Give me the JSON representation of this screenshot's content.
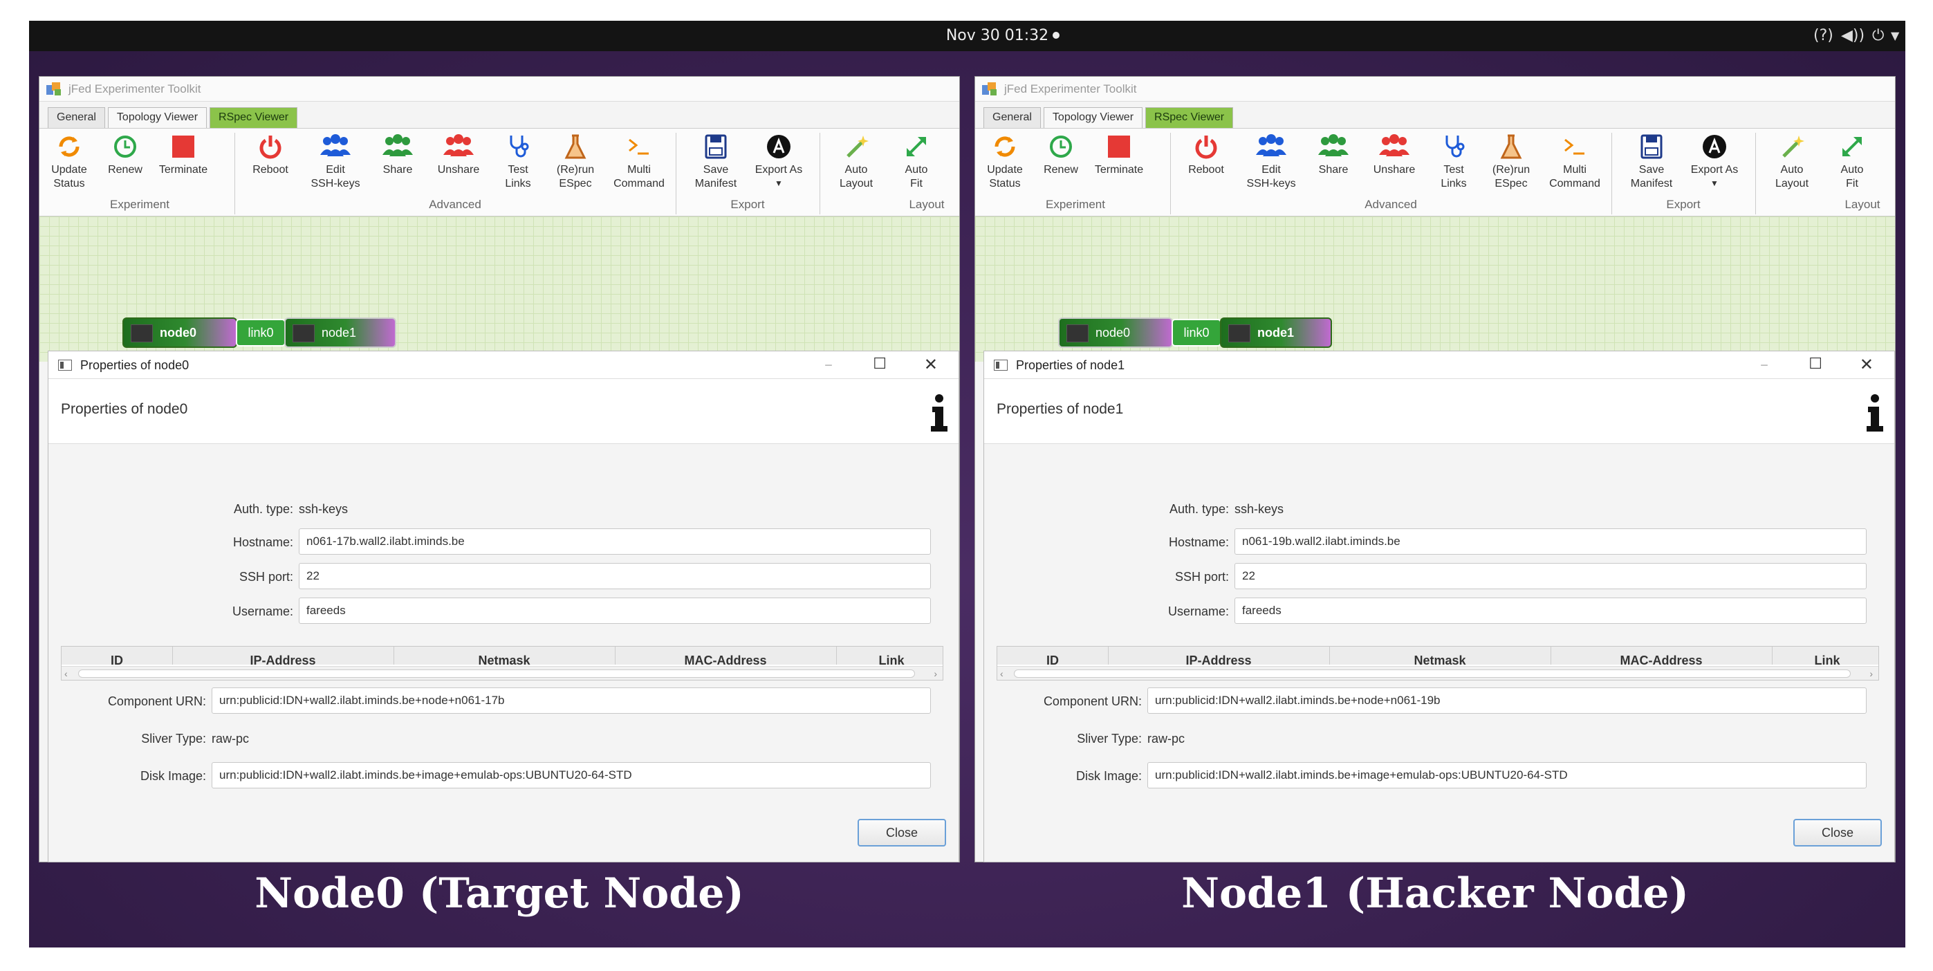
{
  "topbar": {
    "clock": "Nov 30 01:32"
  },
  "captions": {
    "left": "Node0 (Target Node)",
    "right": "Node1 (Hacker Node)"
  },
  "windows": [
    {
      "app_title": "jFed Experimenter Toolkit",
      "tabs": [
        "General",
        "Topology Viewer",
        "RSpec Viewer"
      ],
      "toolbar": {
        "update": "Update\nStatus",
        "renew": "Renew",
        "terminate": "Terminate",
        "reboot": "Reboot",
        "edit_keys": "Edit\nSSH-keys",
        "share": "Share",
        "unshare": "Unshare",
        "test_links": "Test\nLinks",
        "rerun_espec": "(Re)run\nESpec",
        "multi_command": "Multi\nCommand",
        "save_manifest": "Save\nManifest",
        "export_as": "Export As",
        "auto_layout": "Auto\nLayout",
        "auto_fit": "Auto\nFit",
        "groups": {
          "experiment": "Experiment",
          "advanced": "Advanced",
          "export": "Export",
          "layout": "Layout"
        }
      },
      "topology": {
        "node_a": "node0",
        "link": "link0",
        "node_b": "node1"
      },
      "dialog": {
        "title": "Properties of node0",
        "header": "Properties of node0",
        "auth_label": "Auth. type:",
        "auth_value": "ssh-keys",
        "hostname_label": "Hostname:",
        "hostname": "n061-17b.wall2.ilabt.iminds.be",
        "ssh_port_label": "SSH port:",
        "ssh_port": "22",
        "username_label": "Username:",
        "username": "fareeds",
        "columns": [
          "ID",
          "IP-Address",
          "Netmask",
          "MAC-Address",
          "Link"
        ],
        "urn_label": "Component URN:",
        "urn": "urn:publicid:IDN+wall2.ilabt.iminds.be+node+n061-17b",
        "sliver_label": "Sliver Type:",
        "sliver": "raw-pc",
        "disk_label": "Disk Image:",
        "disk": "urn:publicid:IDN+wall2.ilabt.iminds.be+image+emulab-ops:UBUNTU20-64-STD",
        "close": "Close"
      }
    },
    {
      "app_title": "jFed Experimenter Toolkit",
      "tabs": [
        "General",
        "Topology Viewer",
        "RSpec Viewer"
      ],
      "toolbar": {
        "update": "Update\nStatus",
        "renew": "Renew",
        "terminate": "Terminate",
        "reboot": "Reboot",
        "edit_keys": "Edit\nSSH-keys",
        "share": "Share",
        "unshare": "Unshare",
        "test_links": "Test\nLinks",
        "rerun_espec": "(Re)run\nESpec",
        "multi_command": "Multi\nCommand",
        "save_manifest": "Save\nManifest",
        "export_as": "Export As",
        "auto_layout": "Auto\nLayout",
        "auto_fit": "Auto\nFit",
        "groups": {
          "experiment": "Experiment",
          "advanced": "Advanced",
          "export": "Export",
          "layout": "Layout"
        }
      },
      "topology": {
        "node_a": "node0",
        "link": "link0",
        "node_b": "node1"
      },
      "dialog": {
        "title": "Properties of node1",
        "header": "Properties of node1",
        "auth_label": "Auth. type:",
        "auth_value": "ssh-keys",
        "hostname_label": "Hostname:",
        "hostname": "n061-19b.wall2.ilabt.iminds.be",
        "ssh_port_label": "SSH port:",
        "ssh_port": "22",
        "username_label": "Username:",
        "username": "fareeds",
        "columns": [
          "ID",
          "IP-Address",
          "Netmask",
          "MAC-Address",
          "Link"
        ],
        "urn_label": "Component URN:",
        "urn": "urn:publicid:IDN+wall2.ilabt.iminds.be+node+n061-19b",
        "sliver_label": "Sliver Type:",
        "sliver": "raw-pc",
        "disk_label": "Disk Image:",
        "disk": "urn:publicid:IDN+wall2.ilabt.iminds.be+image+emulab-ops:UBUNTU20-64-STD",
        "close": "Close"
      }
    }
  ],
  "icons": {
    "update": "refresh-icon",
    "renew": "clock-icon",
    "terminate": "stop-icon",
    "reboot": "power-icon",
    "edit_keys": "users-icon",
    "share": "users-icon",
    "unshare": "users-icon",
    "test_links": "stethoscope-icon",
    "rerun_espec": "flask-icon",
    "multi_command": "terminal-icon",
    "save_manifest": "save-icon",
    "export_as": "export-icon",
    "auto_layout": "magic-wand-icon",
    "auto_fit": "expand-icon"
  },
  "colors": {
    "accent_green": "#34a53a",
    "rspec_tab": "#8bc34a",
    "grid_bg": "#e4f0d3",
    "terminate_red": "#e53935",
    "people_blue": "#1e5bd8",
    "people_green": "#2e9a3e",
    "people_red": "#e53935"
  }
}
